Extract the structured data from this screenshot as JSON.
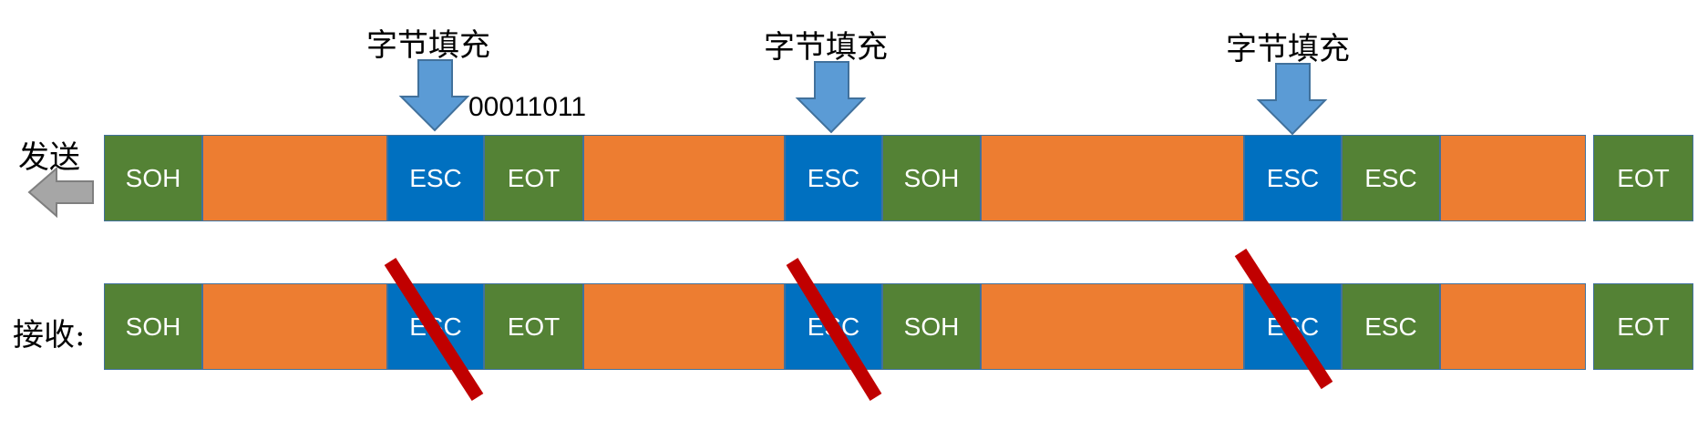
{
  "labels": {
    "send": "发送",
    "receive": "接收:",
    "stuffing": "字节填充",
    "esc_code": "00011011"
  },
  "colors": {
    "control": "#548235",
    "esc": "#0070c0",
    "data": "#ed7d31",
    "arrow": "#5b9bd5",
    "strike": "#c00000"
  },
  "send_row": {
    "cells": [
      {
        "kind": "control",
        "text": "SOH"
      },
      {
        "kind": "data",
        "text": ""
      },
      {
        "kind": "esc",
        "text": "ESC"
      },
      {
        "kind": "control",
        "text": "EOT"
      },
      {
        "kind": "data",
        "text": ""
      },
      {
        "kind": "esc",
        "text": "ESC"
      },
      {
        "kind": "control",
        "text": "SOH"
      },
      {
        "kind": "data",
        "text": ""
      },
      {
        "kind": "esc",
        "text": "ESC"
      },
      {
        "kind": "control",
        "text": "ESC"
      },
      {
        "kind": "data",
        "text": ""
      },
      {
        "kind": "control",
        "text": "EOT"
      }
    ]
  },
  "receive_row": {
    "cells": [
      {
        "kind": "control",
        "text": "SOH"
      },
      {
        "kind": "data",
        "text": ""
      },
      {
        "kind": "esc",
        "text": "ESC"
      },
      {
        "kind": "control",
        "text": "EOT"
      },
      {
        "kind": "data",
        "text": ""
      },
      {
        "kind": "esc",
        "text": "ESC"
      },
      {
        "kind": "control",
        "text": "SOH"
      },
      {
        "kind": "data",
        "text": ""
      },
      {
        "kind": "esc",
        "text": "ESC"
      },
      {
        "kind": "control",
        "text": "ESC"
      },
      {
        "kind": "data",
        "text": ""
      },
      {
        "kind": "control",
        "text": "EOT"
      }
    ]
  }
}
